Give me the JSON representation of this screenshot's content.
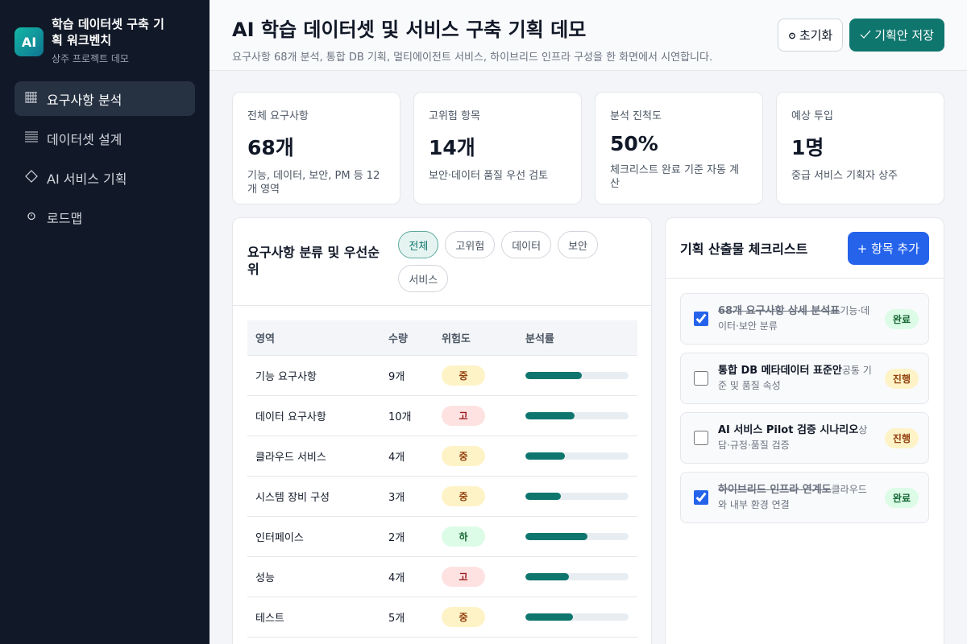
{
  "sidebar": {
    "logo": "AI",
    "title": "학습 데이터셋 구축 기획 워크벤치",
    "subtitle": "상주 프로젝트 데모",
    "items": [
      {
        "icon": "grid-icon",
        "label": "요구사항 분석",
        "active": true
      },
      {
        "icon": "list-icon",
        "label": "데이터셋 설계",
        "active": false
      },
      {
        "icon": "diamond-icon",
        "label": "AI 서비스 기획",
        "active": false
      },
      {
        "icon": "clock-icon",
        "label": "로드맵",
        "active": false
      }
    ]
  },
  "header": {
    "title": "AI 학습 데이터셋 및 서비스 구축 기획 데모",
    "subtitle": "요구사항 68개 분석, 통합 DB 기획, 멀티에이전트 서비스, 하이브리드 인프라 구성을 한 화면에서 시연합니다.",
    "reset_label": "초기화",
    "save_label": "기획안 저장"
  },
  "stats": [
    {
      "label": "전체 요구사항",
      "value": "68개",
      "desc": "기능, 데이터, 보안, PM 등 12개 영역"
    },
    {
      "label": "고위험 항목",
      "value": "14개",
      "desc": "보안·데이터 품질 우선 검토"
    },
    {
      "label": "분석 진척도",
      "value": "50%",
      "desc": "체크리스트 완료 기준 자동 계산"
    },
    {
      "label": "예상 투입",
      "value": "1명",
      "desc": "중급 서비스 기획자 상주"
    }
  ],
  "requirements": {
    "title": "요구사항 분류 및 우선순위",
    "filters": [
      "전체",
      "고위험",
      "데이터",
      "보안",
      "서비스"
    ],
    "active_filter": 0,
    "columns": [
      "영역",
      "수량",
      "위험도",
      "분석률"
    ],
    "rows": [
      {
        "area": "기능 요구사항",
        "count": "9개",
        "risk": "중",
        "level": "mid",
        "progress": 0.55
      },
      {
        "area": "데이터 요구사항",
        "count": "10개",
        "risk": "고",
        "level": "high",
        "progress": 0.48
      },
      {
        "area": "클라우드 서비스",
        "count": "4개",
        "risk": "중",
        "level": "mid",
        "progress": 0.38
      },
      {
        "area": "시스템 장비 구성",
        "count": "3개",
        "risk": "중",
        "level": "mid",
        "progress": 0.34
      },
      {
        "area": "인터페이스",
        "count": "2개",
        "risk": "하",
        "level": "low",
        "progress": 0.6
      },
      {
        "area": "성능",
        "count": "4개",
        "risk": "고",
        "level": "high",
        "progress": 0.42
      },
      {
        "area": "테스트",
        "count": "5개",
        "risk": "중",
        "level": "mid",
        "progress": 0.46
      }
    ]
  },
  "checklist": {
    "title": "기획 산출물 체크리스트",
    "add_label": "+ 항목 추가",
    "items": [
      {
        "name": "68개 요구사항 상세 분석표",
        "desc": "기능·데이터·보안 분류",
        "done": true,
        "status": "완료"
      },
      {
        "name": "통합 DB 메타데이터 표준안",
        "desc": "공통 기준 및 품질 속성",
        "done": false,
        "status": "진행"
      },
      {
        "name": "AI 서비스 Pilot 검증 시나리오",
        "desc": "상담·규정·품질 검증",
        "done": false,
        "status": "진행"
      },
      {
        "name": "하이브리드 인프라 연계도",
        "desc": "클라우드와 내부 환경 연결",
        "done": true,
        "status": "완료"
      }
    ]
  }
}
